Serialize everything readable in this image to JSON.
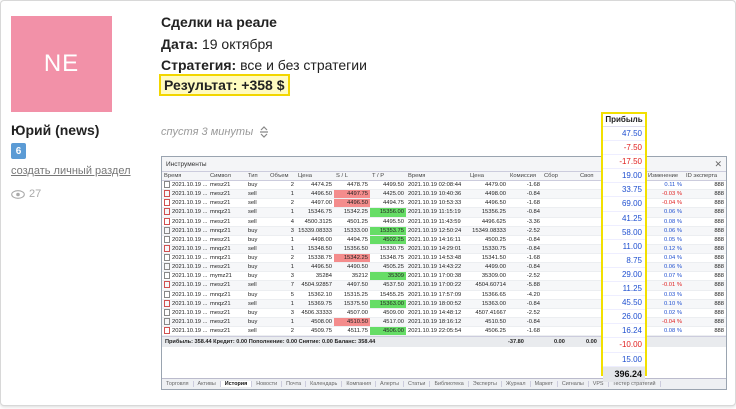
{
  "user": {
    "initials": "NE",
    "name": "Юрий (news)",
    "badge": "6",
    "create_link": "создать личный раздел",
    "views": "27"
  },
  "post": {
    "title": "Сделки на реале",
    "date_label": "Дата:",
    "date_value": "19 октября",
    "strategy_label": "Стратегия:",
    "strategy_value": "все и без стратегии",
    "result": "Результат: +358 $",
    "time_ago": "спустя 3 минуты"
  },
  "terminal": {
    "title": "Инструменты",
    "columns": [
      "Время",
      "Символ",
      "Тип",
      "Объем",
      "Цена",
      "S / L",
      "T / P",
      "Время",
      "Цена",
      "Комиссия",
      "Сбор",
      "Своп"
    ],
    "rows": [
      [
        "2021.10.19 ...",
        "mesz21",
        "buy",
        "2",
        "4474.25",
        "4478.75",
        "4499.50",
        "2021.10.19 02:08:44",
        "4479.00",
        "-1.68",
        "",
        ""
      ],
      [
        "2021.10.19 ...",
        "mesz21",
        "sell",
        "1",
        "4496.50",
        "4497.75",
        "4425.00",
        "2021.10.19 10:40:36",
        "4498.00",
        "-0.84",
        "",
        ""
      ],
      [
        "2021.10.19 ...",
        "mesz21",
        "sell",
        "2",
        "4497.00",
        "4496.50",
        "4494.75",
        "2021.10.19 10:53:33",
        "4496.50",
        "-1.68",
        "",
        ""
      ],
      [
        "2021.10.19 ...",
        "mnqz21",
        "sell",
        "1",
        "15346.75",
        "15342.25",
        "15356.00",
        "2021.10.19 11:15:19",
        "15356.25",
        "-0.84",
        "",
        ""
      ],
      [
        "2021.10.19 ...",
        "mesz21",
        "sell",
        "4",
        "4500.3125",
        "4501.25",
        "4495.50",
        "2021.10.19 11:43:59",
        "4496.625",
        "-3.36",
        "",
        ""
      ],
      [
        "2021.10.19 ...",
        "mnqz21",
        "buy",
        "3",
        "15339.08333",
        "15333.00",
        "15353.75",
        "2021.10.19 12:50:24",
        "15349.08333",
        "-2.52",
        "",
        ""
      ],
      [
        "2021.10.19 ...",
        "mesz21",
        "buy",
        "1",
        "4498.00",
        "4494.75",
        "4502.25",
        "2021.10.19 14:16:11",
        "4500.25",
        "-0.84",
        "",
        ""
      ],
      [
        "2021.10.19 ...",
        "mnqz21",
        "sell",
        "1",
        "15348.50",
        "15356.50",
        "15330.75",
        "2021.10.19 14:29:01",
        "15330.75",
        "-0.84",
        "",
        ""
      ],
      [
        "2021.10.19 ...",
        "mnqz21",
        "buy",
        "2",
        "15338.75",
        "15342.25",
        "15348.75",
        "2021.10.19 14:53:48",
        "15341.50",
        "-1.68",
        "",
        ""
      ],
      [
        "2021.10.19 ...",
        "mesz21",
        "buy",
        "1",
        "4496.50",
        "4490.50",
        "4505.25",
        "2021.10.19 14:43:22",
        "4499.00",
        "-0.84",
        "",
        ""
      ],
      [
        "2021.10.19 ...",
        "mymz21",
        "buy",
        "3",
        "35284",
        "35212",
        "35309",
        "2021.10.19 17:00:38",
        "35309.00",
        "-2.52",
        "",
        ""
      ],
      [
        "2021.10.19 ...",
        "mesz21",
        "sell",
        "7",
        "4504.92857",
        "4497.50",
        "4537.50",
        "2021.10.19 17:00:22",
        "4504.60714",
        "-5.88",
        "",
        ""
      ],
      [
        "2021.10.19 ...",
        "mnqz21",
        "buy",
        "5",
        "15362.10",
        "15315.25",
        "15455.25",
        "2021.10.19 17:57:09",
        "15366.65",
        "-4.20",
        "",
        ""
      ],
      [
        "2021.10.19 ...",
        "mnqz21",
        "sell",
        "1",
        "15369.75",
        "15375.50",
        "15363.00",
        "2021.10.19 18:00:52",
        "15363.00",
        "-0.84",
        "",
        ""
      ],
      [
        "2021.10.19 ...",
        "mesz21",
        "buy",
        "3",
        "4506.33333",
        "4507.00",
        "4509.00",
        "2021.10.19 14:48:12",
        "4507.41667",
        "-2.52",
        "",
        ""
      ],
      [
        "2021.10.19 ...",
        "mesz21",
        "buy",
        "1",
        "4508.00",
        "4510.50",
        "4517.00",
        "2021.10.19 18:16:12",
        "4510.50",
        "-0.84",
        "",
        ""
      ],
      [
        "2021.10.19 ...",
        "mesz21",
        "sell",
        "2",
        "4509.75",
        "4511.75",
        "4506.00",
        "2021.10.19 22:05:54",
        "4506.25",
        "-1.68",
        "",
        ""
      ]
    ],
    "sl_hits": [
      1,
      2,
      8,
      15
    ],
    "tp_hits": [
      3,
      5,
      6,
      10,
      13,
      16
    ],
    "summary": {
      "text": "Прибыль: 358.44  Кредит: 0.00  Пополнение: 0.00  Снятие: 0.00  Баланс: 358.44",
      "commission": "-37.80",
      "fee": "0.00",
      "swap": "0.00"
    },
    "change_header": "Изменение",
    "id_header": "ID эксперта",
    "changes": [
      "0.11 %",
      "-0.03 %",
      "-0.04 %",
      "0.06 %",
      "0.08 %",
      "0.06 %",
      "0.05 %",
      "0.12 %",
      "0.04 %",
      "0.06 %",
      "0.07 %",
      "-0.01 %",
      "0.03 %",
      "0.10 %",
      "0.02 %",
      "-0.04 %",
      "0.08 %"
    ],
    "ids": [
      "888",
      "888",
      "888",
      "888",
      "888",
      "888",
      "888",
      "888",
      "888",
      "888",
      "888",
      "888",
      "888",
      "888",
      "888",
      "888",
      "888"
    ],
    "tabs": [
      "Торговля",
      "Активы",
      "История",
      "Новости",
      "Почта",
      "Календарь",
      "Компания",
      "Алерты",
      "Статьи",
      "Библиотека",
      "Эксперты",
      "Журнал",
      "Маркет",
      "Сигналы",
      "VPS",
      "Тестер стратегий"
    ],
    "active_tab": "История"
  },
  "profit": {
    "header": "Прибыль",
    "values": [
      "47.50",
      "-7.50",
      "-17.50",
      "19.00",
      "33.75",
      "69.00",
      "41.25",
      "58.00",
      "11.00",
      "8.75",
      "29.00",
      "11.25",
      "45.50",
      "26.00",
      "16.24",
      "-10.00",
      "15.00"
    ],
    "total": "396.24"
  },
  "colors": {
    "positive": "#2050d0",
    "negative": "#e02020",
    "highlight": "#f2e000"
  }
}
